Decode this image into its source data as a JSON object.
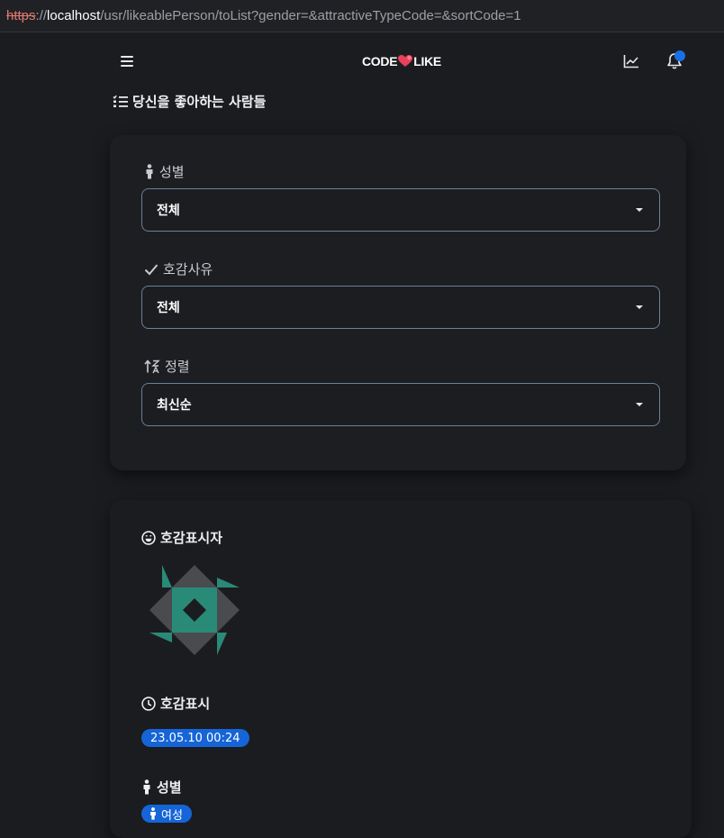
{
  "browser": {
    "url_scheme": "https",
    "url_sep": "://",
    "url_host": "localhost",
    "url_path": "/usr/likeablePerson/toList?gender=&attractiveTypeCode=&sortCode=1"
  },
  "header": {
    "logo_left": "CODE",
    "logo_right": "LIKE",
    "accent_color": "#e8415c",
    "notification_dot_color": "#1a6ee6"
  },
  "page": {
    "title": "당신을 좋아하는 사람들"
  },
  "filters": {
    "gender": {
      "label": "성별",
      "value": "전체"
    },
    "attractive_type": {
      "label": "호감사유",
      "value": "전체"
    },
    "sort": {
      "label": "정렬",
      "value": "최신순"
    }
  },
  "result": {
    "liker_label": "호감표시자",
    "liked_at_label": "호감표시",
    "liked_at_value": "23.05.10 00:24",
    "gender_label": "성별",
    "gender_value": "여성",
    "badge_color": "#1565d8"
  }
}
